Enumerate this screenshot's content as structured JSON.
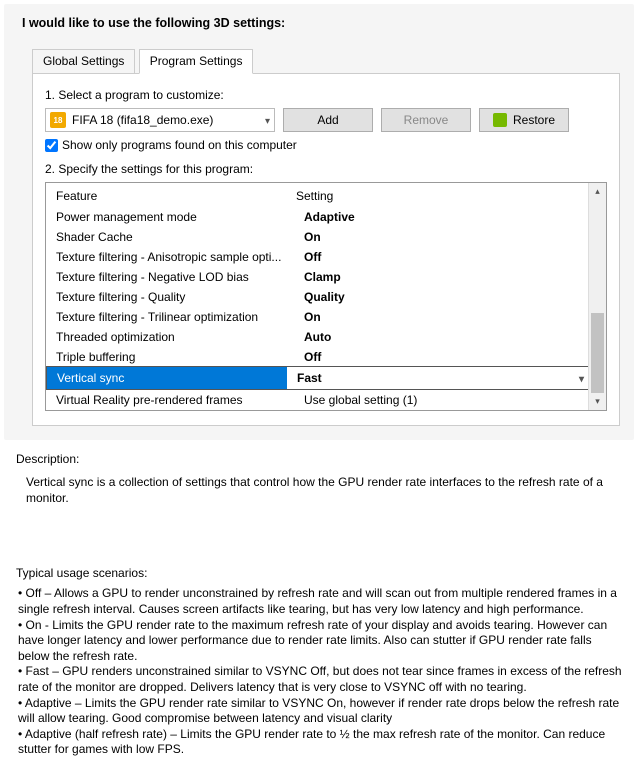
{
  "heading": "I would like to use the following 3D settings:",
  "tabs": {
    "global": "Global Settings",
    "program": "Program Settings"
  },
  "step1_label": "1. Select a program to customize:",
  "program": {
    "icon_text": "18",
    "name": "FIFA 18 (fifa18_demo.exe)"
  },
  "buttons": {
    "add": "Add",
    "remove": "Remove",
    "restore": "Restore"
  },
  "show_only_label": "Show only programs found on this computer",
  "step2_label": "2. Specify the settings for this program:",
  "headers": {
    "feature": "Feature",
    "setting": "Setting"
  },
  "settings": [
    {
      "feature": "Power management mode",
      "value": "Adaptive"
    },
    {
      "feature": "Shader Cache",
      "value": "On"
    },
    {
      "feature": "Texture filtering - Anisotropic sample opti...",
      "value": "Off"
    },
    {
      "feature": "Texture filtering - Negative LOD bias",
      "value": "Clamp"
    },
    {
      "feature": "Texture filtering - Quality",
      "value": "Quality"
    },
    {
      "feature": "Texture filtering - Trilinear optimization",
      "value": "On"
    },
    {
      "feature": "Threaded optimization",
      "value": "Auto"
    },
    {
      "feature": "Triple buffering",
      "value": "Off"
    }
  ],
  "selected": {
    "feature": "Vertical sync",
    "value": "Fast"
  },
  "after_selected": {
    "feature": "Virtual Reality pre-rendered frames",
    "value": "Use global setting (1)"
  },
  "description_title": "Description:",
  "description_body": "Vertical sync is a collection of settings that control how the GPU render rate interfaces to the refresh rate of a monitor.",
  "scenarios_title": "Typical usage scenarios:",
  "scenarios": [
    "• Off – Allows a GPU to render unconstrained by refresh rate and will scan out from multiple rendered frames in a single refresh interval. Causes screen artifacts like tearing, but has very low latency and high performance.",
    "• On - Limits the GPU render rate to the maximum refresh rate of your display and avoids tearing. However can have longer latency and lower performance due to render rate limits. Also can stutter if GPU render rate falls below the refresh rate.",
    "• Fast – GPU renders unconstrained similar to VSYNC Off, but does not tear since frames in excess of the refresh rate of the monitor are dropped. Delivers latency that is very close to VSYNC off with no tearing.",
    "• Adaptive – Limits the GPU render rate similar to VSYNC On, however if render rate drops below the refresh rate will allow tearing. Good compromise between latency and visual clarity",
    "• Adaptive (half refresh rate) – Limits the GPU render rate to ½ the max refresh rate of the monitor. Can reduce stutter for games with low FPS."
  ]
}
